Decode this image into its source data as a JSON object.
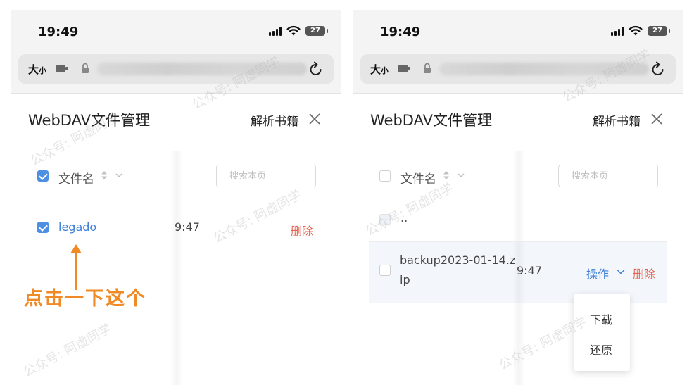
{
  "status_bar": {
    "time": "19:49",
    "battery": "27"
  },
  "browser": {
    "text_size_label": "大",
    "text_size_small": "小"
  },
  "panel": {
    "title": "WebDAV文件管理",
    "parse_button": "解析书籍"
  },
  "table": {
    "name_header": "文件名",
    "search_placeholder": "搜索本页"
  },
  "left": {
    "rows": [
      {
        "name": "legado",
        "time_fragment": "9:47",
        "action": "删除",
        "checked": true
      }
    ]
  },
  "right": {
    "rows": [
      {
        "name": "..",
        "checked": false
      },
      {
        "name_line1": "backup2023-01-14.z",
        "name_line2": "ip",
        "time_fragment": "9:47",
        "op_label": "操作",
        "action": "删除",
        "checked": false
      }
    ],
    "dropdown": {
      "download": "下载",
      "restore": "还原"
    }
  },
  "annotation": {
    "text": "点击一下这个",
    "color": "#f08a24"
  },
  "watermark": "公众号: 阿虚同学",
  "colors": {
    "accent": "#3d7fd6",
    "danger": "#e0624f",
    "checkbox": "#4d8fe3"
  }
}
